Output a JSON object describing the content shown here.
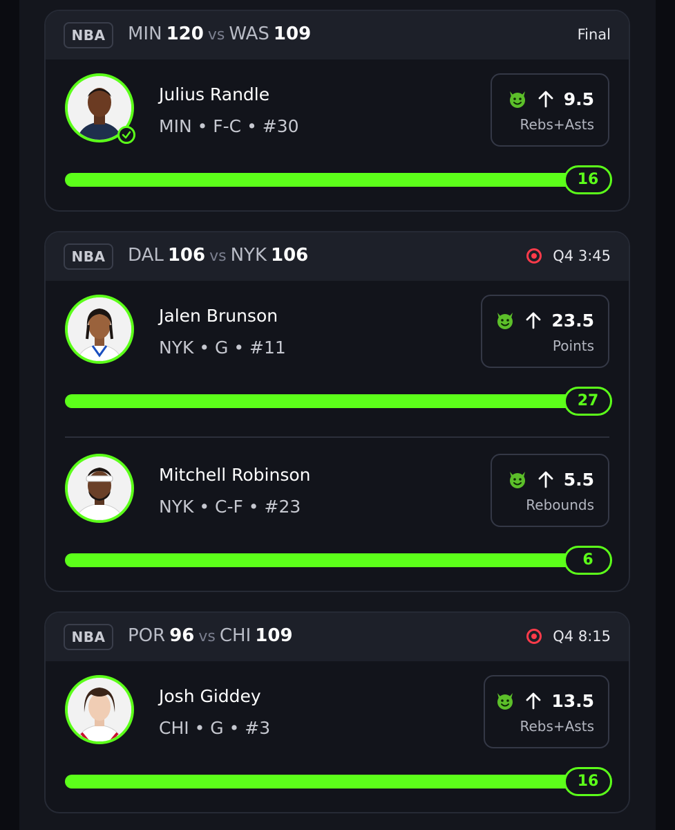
{
  "games": [
    {
      "league": "NBA",
      "away_team": "MIN",
      "away_score": "120",
      "vs": "vs",
      "home_team": "WAS",
      "home_score": "109",
      "status": "Final",
      "live": false,
      "players": [
        {
          "name": "Julius Randle",
          "meta": "MIN • F-C • #30",
          "direction_icon": "arrow-up-icon",
          "line": "9.5",
          "stat": "Rebs+Asts",
          "result": "16",
          "progress_fraction": 1.0,
          "hit": true
        }
      ]
    },
    {
      "league": "NBA",
      "away_team": "DAL",
      "away_score": "106",
      "vs": "vs",
      "home_team": "NYK",
      "home_score": "106",
      "status": "Q4 3:45",
      "live": true,
      "players": [
        {
          "name": "Jalen Brunson",
          "meta": "NYK • G • #11",
          "direction_icon": "arrow-up-icon",
          "line": "23.5",
          "stat": "Points",
          "result": "27",
          "progress_fraction": 1.0,
          "hit": false
        },
        {
          "name": "Mitchell Robinson",
          "meta": "NYK • C-F • #23",
          "direction_icon": "arrow-up-icon",
          "line": "5.5",
          "stat": "Rebounds",
          "result": "6",
          "progress_fraction": 1.0,
          "hit": false
        }
      ]
    },
    {
      "league": "NBA",
      "away_team": "POR",
      "away_score": "96",
      "vs": "vs",
      "home_team": "CHI",
      "home_score": "109",
      "status": "Q4 8:15",
      "live": true,
      "players": [
        {
          "name": "Josh Giddey",
          "meta": "CHI • G • #3",
          "direction_icon": "arrow-up-icon",
          "line": "13.5",
          "stat": "Rebs+Asts",
          "result": "16",
          "progress_fraction": 1.0,
          "hit": false
        }
      ]
    }
  ],
  "colors": {
    "accent_green": "#5cff1a",
    "live_red": "#ff3b4a",
    "background": "#0b0c11",
    "card": "#12141b",
    "card_header": "#1d2029"
  }
}
